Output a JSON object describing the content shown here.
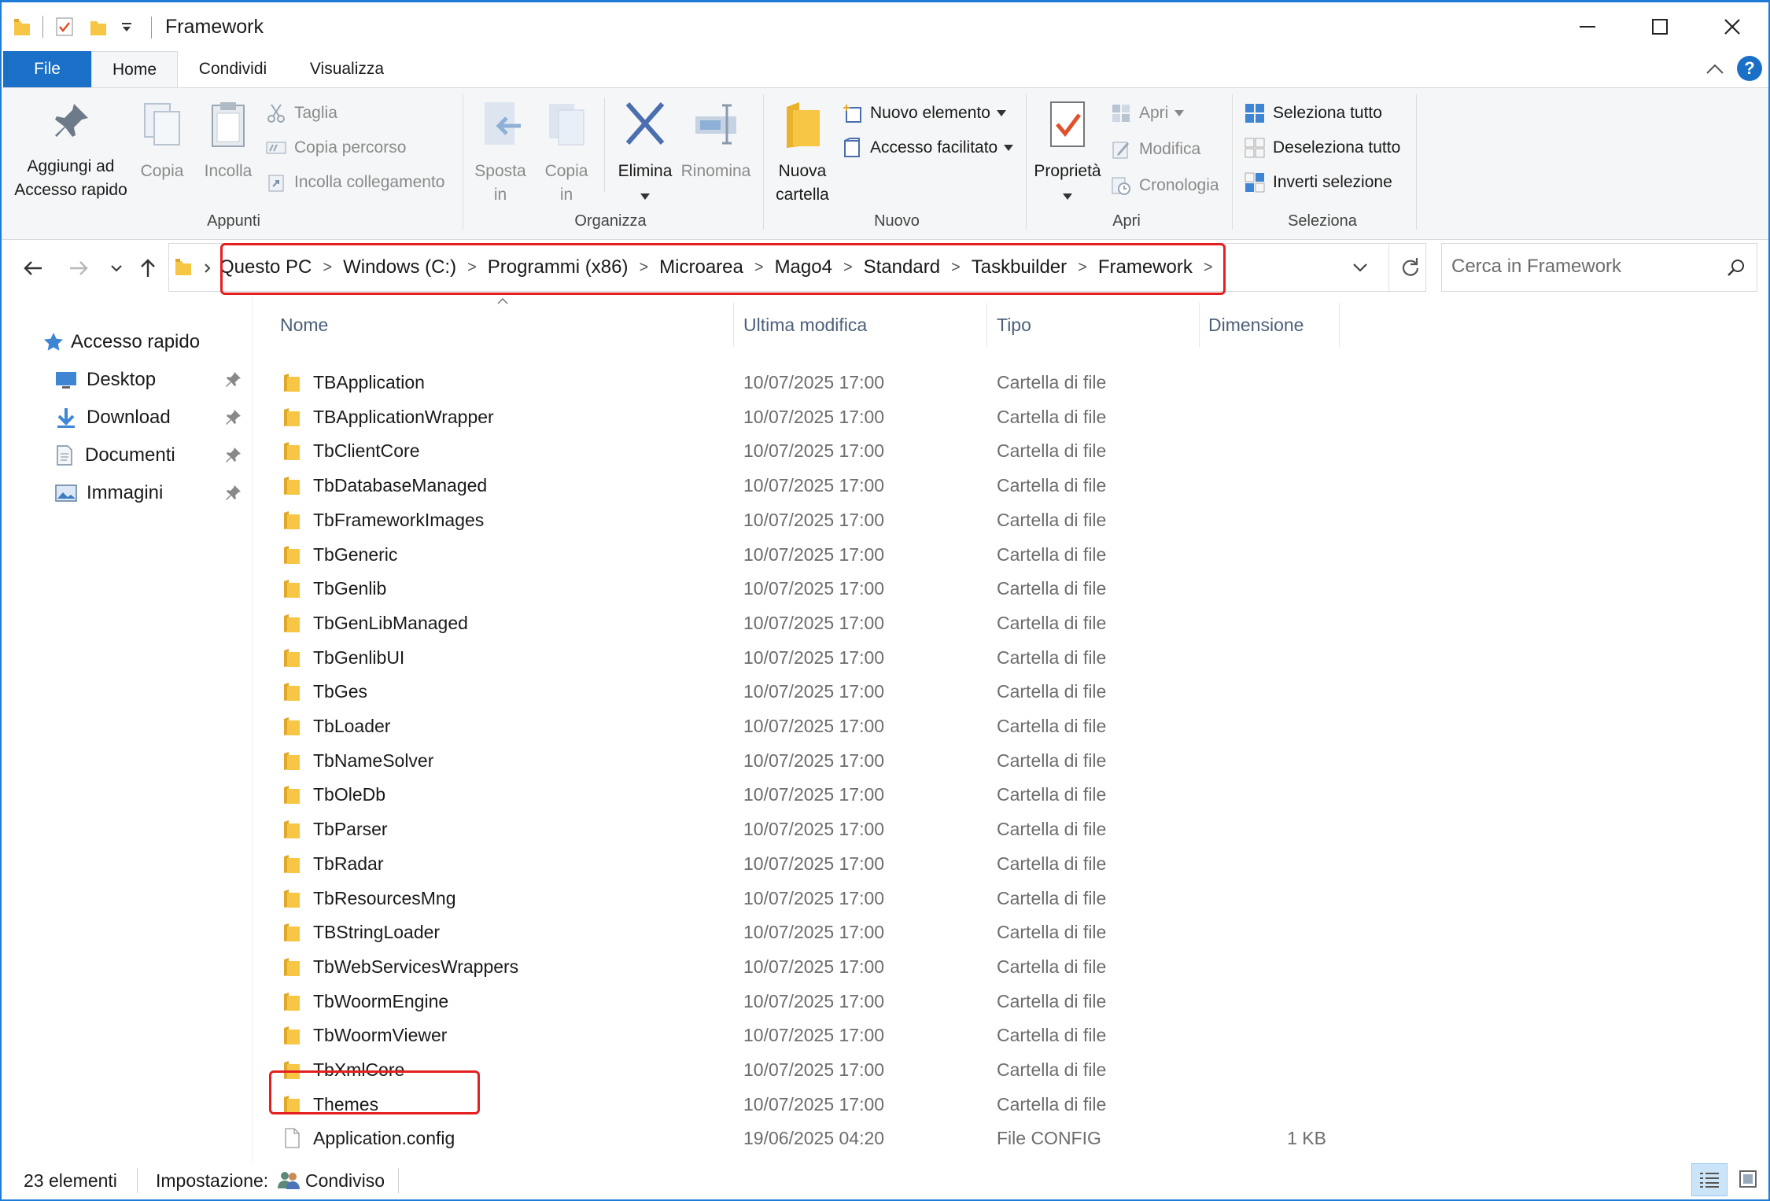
{
  "window": {
    "title": "Framework"
  },
  "ribbon_tabs": {
    "file": "File",
    "home": "Home",
    "share": "Condividi",
    "view": "Visualizza"
  },
  "ribbon": {
    "clipboard": {
      "group_label": "Appunti",
      "pin_line1": "Aggiungi ad",
      "pin_line2": "Accesso rapido",
      "copy": "Copia",
      "paste": "Incolla",
      "cut": "Taglia",
      "copy_path": "Copia percorso",
      "paste_shortcut": "Incolla collegamento"
    },
    "organize": {
      "group_label": "Organizza",
      "move_line1": "Sposta",
      "move_line2": "in",
      "copyto_line1": "Copia",
      "copyto_line2": "in",
      "delete": "Elimina",
      "rename": "Rinomina"
    },
    "new": {
      "group_label": "Nuovo",
      "folder_line1": "Nuova",
      "folder_line2": "cartella",
      "new_item": "Nuovo elemento",
      "easy_access": "Accesso facilitato"
    },
    "open": {
      "group_label": "Apri",
      "properties": "Proprietà",
      "open": "Apri",
      "edit": "Modifica",
      "history": "Cronologia"
    },
    "select": {
      "group_label": "Seleziona",
      "select_all": "Seleziona tutto",
      "select_none": "Deseleziona tutto",
      "invert": "Inverti selezione"
    }
  },
  "address": {
    "crumbs": [
      "Questo PC",
      "Windows (C:)",
      "Programmi (x86)",
      "Microarea",
      "Mago4",
      "Standard",
      "Taskbuilder",
      "Framework"
    ]
  },
  "search": {
    "placeholder": "Cerca in Framework"
  },
  "nav": {
    "quick_access": "Accesso rapido",
    "items": [
      "Desktop",
      "Download",
      "Documenti",
      "Immagini"
    ]
  },
  "columns": {
    "name": "Nome",
    "modified": "Ultima modifica",
    "type": "Tipo",
    "size": "Dimensione"
  },
  "files": [
    {
      "name": "TBApplication",
      "date": "10/07/2025 17:00",
      "type": "Cartella di file",
      "size": ""
    },
    {
      "name": "TBApplicationWrapper",
      "date": "10/07/2025 17:00",
      "type": "Cartella di file",
      "size": ""
    },
    {
      "name": "TbClientCore",
      "date": "10/07/2025 17:00",
      "type": "Cartella di file",
      "size": ""
    },
    {
      "name": "TbDatabaseManaged",
      "date": "10/07/2025 17:00",
      "type": "Cartella di file",
      "size": ""
    },
    {
      "name": "TbFrameworkImages",
      "date": "10/07/2025 17:00",
      "type": "Cartella di file",
      "size": ""
    },
    {
      "name": "TbGeneric",
      "date": "10/07/2025 17:00",
      "type": "Cartella di file",
      "size": ""
    },
    {
      "name": "TbGenlib",
      "date": "10/07/2025 17:00",
      "type": "Cartella di file",
      "size": ""
    },
    {
      "name": "TbGenLibManaged",
      "date": "10/07/2025 17:00",
      "type": "Cartella di file",
      "size": ""
    },
    {
      "name": "TbGenlibUI",
      "date": "10/07/2025 17:00",
      "type": "Cartella di file",
      "size": ""
    },
    {
      "name": "TbGes",
      "date": "10/07/2025 17:00",
      "type": "Cartella di file",
      "size": ""
    },
    {
      "name": "TbLoader",
      "date": "10/07/2025 17:00",
      "type": "Cartella di file",
      "size": ""
    },
    {
      "name": "TbNameSolver",
      "date": "10/07/2025 17:00",
      "type": "Cartella di file",
      "size": ""
    },
    {
      "name": "TbOleDb",
      "date": "10/07/2025 17:00",
      "type": "Cartella di file",
      "size": ""
    },
    {
      "name": "TbParser",
      "date": "10/07/2025 17:00",
      "type": "Cartella di file",
      "size": ""
    },
    {
      "name": "TbRadar",
      "date": "10/07/2025 17:00",
      "type": "Cartella di file",
      "size": ""
    },
    {
      "name": "TbResourcesMng",
      "date": "10/07/2025 17:00",
      "type": "Cartella di file",
      "size": ""
    },
    {
      "name": "TBStringLoader",
      "date": "10/07/2025 17:00",
      "type": "Cartella di file",
      "size": ""
    },
    {
      "name": "TbWebServicesWrappers",
      "date": "10/07/2025 17:00",
      "type": "Cartella di file",
      "size": ""
    },
    {
      "name": "TbWoormEngine",
      "date": "10/07/2025 17:00",
      "type": "Cartella di file",
      "size": ""
    },
    {
      "name": "TbWoormViewer",
      "date": "10/07/2025 17:00",
      "type": "Cartella di file",
      "size": ""
    },
    {
      "name": "TbXmlCore",
      "date": "10/07/2025 17:00",
      "type": "Cartella di file",
      "size": ""
    },
    {
      "name": "Themes",
      "date": "10/07/2025 17:00",
      "type": "Cartella di file",
      "size": ""
    },
    {
      "name": "Application.config",
      "date": "19/06/2025 04:20",
      "type": "File CONFIG",
      "size": "1 KB"
    }
  ],
  "status": {
    "count": "23 elementi",
    "setting_label": "Impostazione:",
    "setting_value": "Condiviso"
  },
  "colors": {
    "accent": "#1a6fc7",
    "highlight": "#e41f1f",
    "folder": "#f6c644"
  }
}
